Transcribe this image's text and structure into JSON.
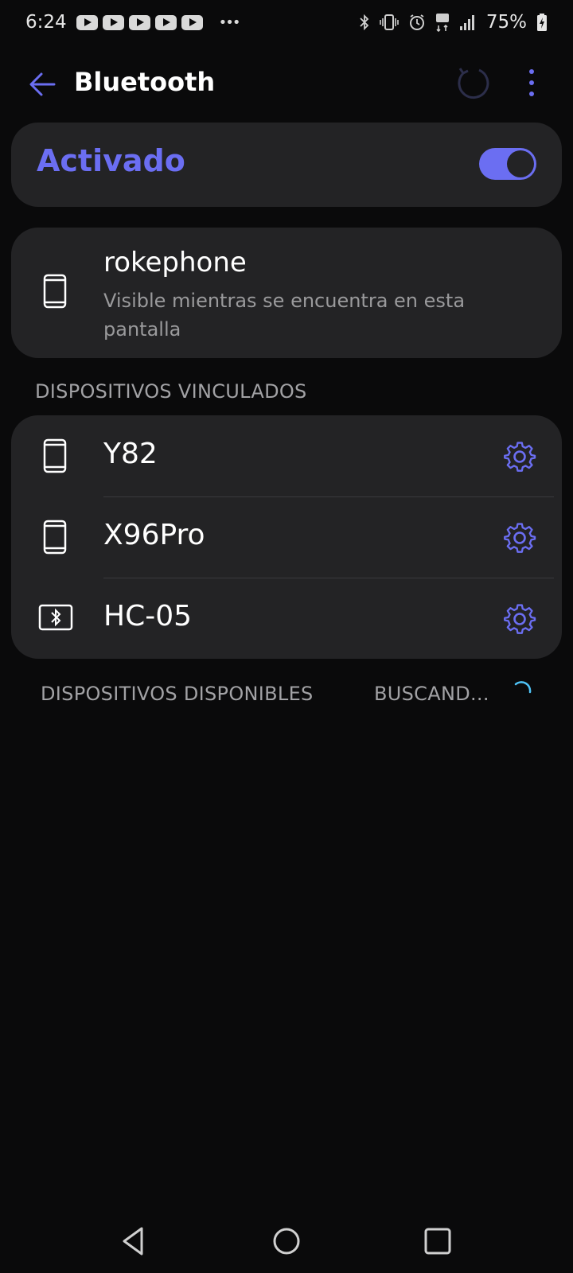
{
  "status_bar": {
    "time": "6:24",
    "battery_percent": "75%",
    "notification_icons": [
      "youtube-icon",
      "youtube-icon",
      "youtube-icon",
      "youtube-icon",
      "youtube-icon",
      "more-dots-icon"
    ],
    "right_icons": [
      "bluetooth-icon",
      "vibrate-icon",
      "alarm-icon",
      "lte-icon",
      "signal-icon",
      "battery-icon"
    ]
  },
  "header": {
    "title": "Bluetooth",
    "icons": [
      "back-arrow-icon",
      "refresh-icon",
      "overflow-menu-icon"
    ]
  },
  "toggle": {
    "label": "Activado",
    "checked": true
  },
  "this_device": {
    "name": "rokephone",
    "subtitle": "Visible mientras se encuentra en esta pantalla",
    "icon": "phone-icon"
  },
  "paired": {
    "section_title": "DISPOSITIVOS VINCULADOS",
    "devices": [
      {
        "name": "Y82",
        "icon": "phone-icon"
      },
      {
        "name": "X96Pro",
        "icon": "phone-icon"
      },
      {
        "name": "HC-05",
        "icon": "bluetooth-device-icon"
      }
    ]
  },
  "available": {
    "section_title": "DISPOSITIVOS DISPONIBLES",
    "status": "BUSCAND..."
  },
  "colors": {
    "accent": "#6b6ef2",
    "background": "#0a0a0b",
    "card": "#232325",
    "secondary_text": "#9a9a9c",
    "spinner": "#4fc3f7"
  }
}
